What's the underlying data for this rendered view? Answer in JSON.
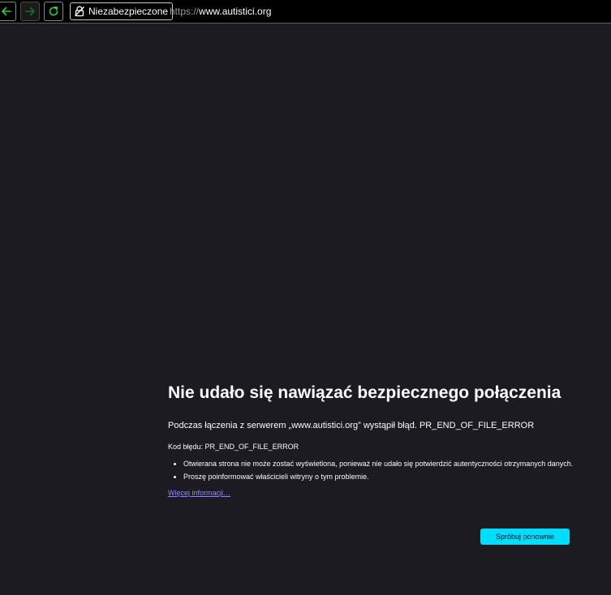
{
  "toolbar": {
    "back_icon": "arrow-left-icon",
    "forward_icon": "arrow-right-icon",
    "reload_icon": "reload-icon",
    "nav_icon_color": "#2ecc40",
    "security": {
      "icon": "insecure-lock-icon",
      "label": "Niezabezpieczone"
    },
    "url": {
      "scheme": "https://",
      "host": "www.autistici.org"
    }
  },
  "error": {
    "title": "Nie udało się nawiązać bezpiecznego połączenia",
    "description": "Podczas łączenia z serwerem „www.autistici.org” wystąpił błąd. PR_END_OF_FILE_ERROR",
    "code_line": "Kod błędu: PR_END_OF_FILE_ERROR",
    "bullets": [
      "Otwierana strona nie może zostać wyświetlona, ponieważ nie udało się potwierdzić autentyczności otrzymanych danych.",
      "Proszę poinformować właścicieli witryny o tym problemie."
    ],
    "learn_more": "Więcej informacji…",
    "retry_button": "Spróbuj ponownie"
  },
  "colors": {
    "page_background": "#1c1b22",
    "accent_button": "#00ddff",
    "link": "#8c8cff"
  }
}
